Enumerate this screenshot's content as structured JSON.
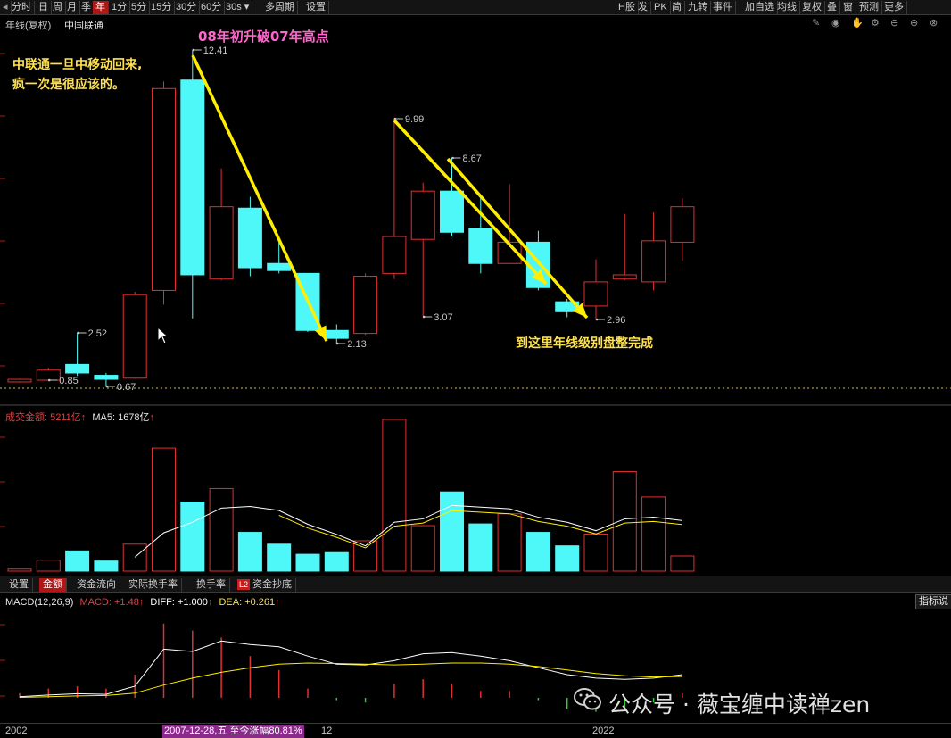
{
  "toolbar": {
    "left": [
      "分时",
      "日",
      "周",
      "月",
      "季",
      "年",
      "1分",
      "5分",
      "15分",
      "30分",
      "60分",
      "30s",
      "多周期",
      "设置"
    ],
    "active": "年",
    "right": [
      "H股",
      "发",
      "PK",
      "简",
      "九转",
      "事件",
      "加自选",
      "均线",
      "复权",
      "叠",
      "窗",
      "预测",
      "更多"
    ]
  },
  "header": {
    "period_label": "年线(复权)",
    "stock_name": "中国联通"
  },
  "annotations": {
    "top_title": "08年初升破07年高点",
    "left_note_1": "中联通一旦中移动回来,",
    "left_note_2": "疯一次是很应该的。",
    "right_note": "到这里年线级别盘整完成"
  },
  "volume_header": {
    "label": "成交金额: 5211亿",
    "ma_label": "MA5: 1678亿"
  },
  "tabs": [
    "设置",
    "金额",
    "资金流向",
    "实际换手率",
    "换手率",
    "资金抄底"
  ],
  "tabs_active": "金额",
  "tab_badge": "L2",
  "macd_header": {
    "name": "MACD(12,26,9)",
    "macd": "MACD: +1.48",
    "diff": "DIFF: +1.000",
    "dea": "DEA: +0.261"
  },
  "indicator_btn": "指标说",
  "axis": {
    "start": "2002",
    "highlight": "2007-12-28,五 至今涨幅80.81%",
    "after": "12",
    "end": "2022"
  },
  "watermark": "公众号 · 薇宝缠中读禅zen",
  "chart_data": [
    {
      "type": "candlestick",
      "title": "年线(复权) 中国联通",
      "colors": {
        "up": "#e03030",
        "down": "#4ff8f8"
      },
      "candles": [
        {
          "o": 0.8,
          "c": 0.88,
          "h": 0.9,
          "l": 0.78
        },
        {
          "o": 0.85,
          "c": 1.2,
          "h": 1.28,
          "l": 0.85
        },
        {
          "o": 1.4,
          "c": 1.1,
          "h": 2.52,
          "l": 1.0
        },
        {
          "o": 1.02,
          "c": 0.88,
          "h": 1.1,
          "l": 0.67
        },
        {
          "o": 0.92,
          "c": 3.85,
          "h": 3.95,
          "l": 0.9
        },
        {
          "o": 4.0,
          "c": 11.05,
          "h": 11.3,
          "l": 3.5
        },
        {
          "o": 11.35,
          "c": 4.55,
          "h": 12.41,
          "l": 3.0
        },
        {
          "o": 4.4,
          "c": 6.95,
          "h": 8.3,
          "l": 4.35
        },
        {
          "o": 6.9,
          "c": 4.8,
          "h": 7.3,
          "l": 4.5
        },
        {
          "o": 4.95,
          "c": 4.7,
          "h": 5.85,
          "l": 4.6
        },
        {
          "o": 4.6,
          "c": 2.6,
          "h": 4.6,
          "l": 2.55
        },
        {
          "o": 2.6,
          "c": 2.32,
          "h": 2.8,
          "l": 2.13
        },
        {
          "o": 2.5,
          "c": 4.5,
          "h": 4.6,
          "l": 2.45
        },
        {
          "o": 4.6,
          "c": 5.9,
          "h": 9.99,
          "l": 4.4
        },
        {
          "o": 5.8,
          "c": 7.5,
          "h": 7.8,
          "l": 3.07
        },
        {
          "o": 7.5,
          "c": 6.05,
          "h": 8.67,
          "l": 5.9
        },
        {
          "o": 6.2,
          "c": 4.95,
          "h": 7.35,
          "l": 4.6
        },
        {
          "o": 4.95,
          "c": 5.7,
          "h": 7.75,
          "l": 4.95
        },
        {
          "o": 5.7,
          "c": 4.1,
          "h": 6.1,
          "l": 4.0
        },
        {
          "o": 3.6,
          "c": 3.25,
          "h": 3.7,
          "l": 3.05
        },
        {
          "o": 3.45,
          "c": 4.3,
          "h": 5.1,
          "l": 2.96
        },
        {
          "o": 4.4,
          "c": 4.55,
          "h": 6.7,
          "l": 4.35
        },
        {
          "o": 4.3,
          "c": 5.75,
          "h": 6.75,
          "l": 4.0
        },
        {
          "o": 5.7,
          "c": 6.95,
          "h": 7.25,
          "l": 5.05
        }
      ],
      "price_labels": [
        {
          "i": 1,
          "v": 0.85,
          "text": "0.85",
          "at": "low"
        },
        {
          "i": 2,
          "v": 2.52,
          "text": "2.52",
          "at": "high"
        },
        {
          "i": 3,
          "v": 0.67,
          "text": "0.67",
          "at": "low"
        },
        {
          "i": 6,
          "v": 12.41,
          "text": "12.41",
          "at": "high"
        },
        {
          "i": 11,
          "v": 2.13,
          "text": "2.13",
          "at": "low"
        },
        {
          "i": 13,
          "v": 9.99,
          "text": "9.99",
          "at": "high"
        },
        {
          "i": 14,
          "v": 3.07,
          "text": "3.07",
          "at": "low"
        },
        {
          "i": 15,
          "v": 8.67,
          "text": "8.67",
          "at": "high"
        },
        {
          "i": 20,
          "v": 2.96,
          "text": "2.96",
          "at": "low"
        }
      ]
    },
    {
      "type": "bar",
      "title": "成交金额",
      "unit": "亿",
      "values": [
        120,
        650,
        1200,
        600,
        1600,
        7300,
        4100,
        4900,
        2300,
        1600,
        1000,
        1100,
        1800,
        9000,
        2700,
        4700,
        2800,
        3400,
        2300,
        1500,
        2200,
        5900,
        4400,
        900
      ],
      "ma5": [
        null,
        null,
        null,
        null,
        830,
        2270,
        2900,
        3740,
        3840,
        3600,
        2780,
        2180,
        1500,
        2900,
        3100,
        3900,
        3800,
        3700,
        3200,
        2900,
        2400,
        3100,
        3200,
        3000
      ]
    },
    {
      "type": "macd",
      "title": "MACD(12,26,9)",
      "bars": [
        0.2,
        0.4,
        0.5,
        0.4,
        1.0,
        3.2,
        2.9,
        2.6,
        1.8,
        1.2,
        0.4,
        -0.1,
        -0.2,
        0.6,
        0.8,
        0.6,
        0.3,
        0.3,
        -0.1,
        -0.5,
        -0.6,
        -0.4,
        -0.2,
        0.2
      ],
      "diff": [
        0.05,
        0.12,
        0.18,
        0.15,
        0.5,
        2.1,
        2.0,
        2.45,
        2.3,
        2.2,
        1.8,
        1.45,
        1.42,
        1.6,
        1.9,
        1.95,
        1.8,
        1.6,
        1.3,
        1.0,
        0.85,
        0.8,
        0.85,
        1.0
      ],
      "dea": [
        0.02,
        0.05,
        0.08,
        0.1,
        0.2,
        0.55,
        0.85,
        1.1,
        1.3,
        1.45,
        1.5,
        1.48,
        1.45,
        1.42,
        1.45,
        1.5,
        1.5,
        1.45,
        1.35,
        1.2,
        1.05,
        0.95,
        0.9,
        0.92
      ]
    }
  ]
}
